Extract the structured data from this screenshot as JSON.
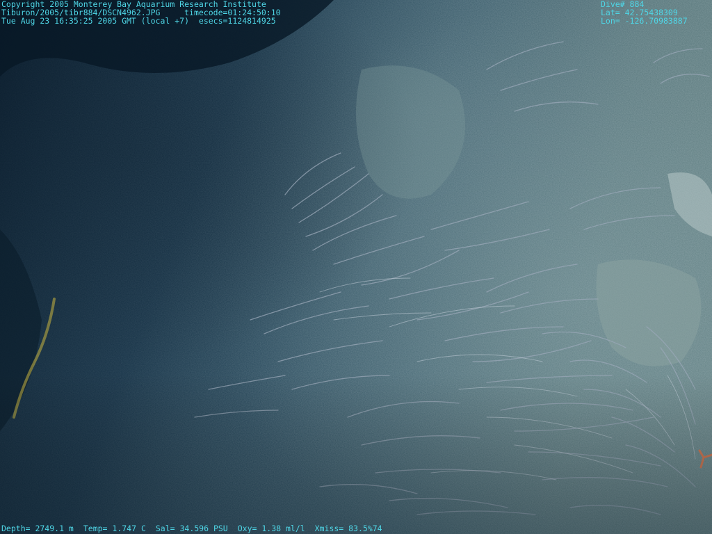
{
  "image": {
    "description": "",
    "header_left": {
      "copyright": "Copyright 2005 Monterey Bay Aquarium Research Institute",
      "file_label": "Tiburon/2005/tibr884/DSCN4962.JPG",
      "timecode": "timecode=01:24:50:10",
      "date_label": "Tue Aug 23 16:35:25 2005 GMT (local +7)",
      "esecs": "esecs=1124814925"
    },
    "header_right": {
      "dive": "Dive# 884",
      "lat": "Lat= 42.75438309",
      "lon": "Lon= -126.70983887"
    },
    "footer": {
      "depth": "Depth= 2749.1 m",
      "temp": "Temp= 1.747 C",
      "sal": "Sal= 34.596 PSU",
      "oxy": "Oxy= 1.38 ml/l",
      "xmiss": "Xmiss= 83.5%74"
    },
    "colors": {
      "overlay_text": "#4fd6e6",
      "water_dark": "#0c2234",
      "sediment": "#5e7c7e",
      "tubeworms": "#9aa8b8"
    }
  }
}
